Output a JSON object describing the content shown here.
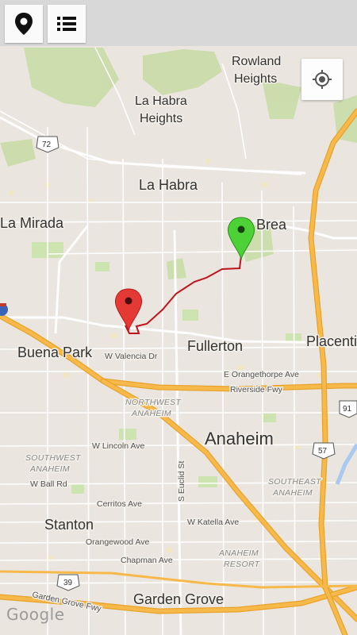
{
  "toolbar": {
    "location_button": "location-pin",
    "list_button": "list"
  },
  "map": {
    "labels": {
      "rowland_1": "Rowland",
      "rowland_2": "Heights",
      "lahabra_heights_1": "La Habra",
      "lahabra_heights_2": "Heights",
      "lahabra": "La Habra",
      "lamirada": "La Mirada",
      "brea": "Brea",
      "buena_park": "Buena Park",
      "fullerton": "Fullerton",
      "placentia": "Placentia",
      "anaheim": "Anaheim",
      "stanton": "Stanton",
      "garden_grove": "Garden Grove",
      "w_valencia": "W Valencia Dr",
      "e_orangethorpe": "E Orangethorpe Ave",
      "riverside_fwy": "Riverside Fwy",
      "w_lincoln": "W Lincoln Ave",
      "w_ball": "W Ball Rd",
      "cerritos": "Cerritos Ave",
      "orangewood": "Orangewood Ave",
      "chapman": "Chapman Ave",
      "w_katella": "W Katella Ave",
      "s_euclid": "S Euclid St",
      "garden_grove_fwy": "Garden Grove Fwy",
      "nw_anaheim_1": "NORTHWEST",
      "nw_anaheim_2": "ANAHEIM",
      "sw_anaheim_1": "SOUTHWEST",
      "sw_anaheim_2": "ANAHEIM",
      "se_anaheim_1": "SOUTHEAST",
      "se_anaheim_2": "ANAHEIM",
      "resort_1": "ANAHEIM",
      "resort_2": "RESORT"
    },
    "shields": {
      "r72": "72",
      "r91": "91",
      "r57": "57",
      "r39": "39"
    },
    "markers": {
      "start_color": "#e53935",
      "end_color": "#4cd137",
      "route_color": "#c0141c"
    },
    "gps_button": "my-location",
    "attribution": "Google"
  }
}
